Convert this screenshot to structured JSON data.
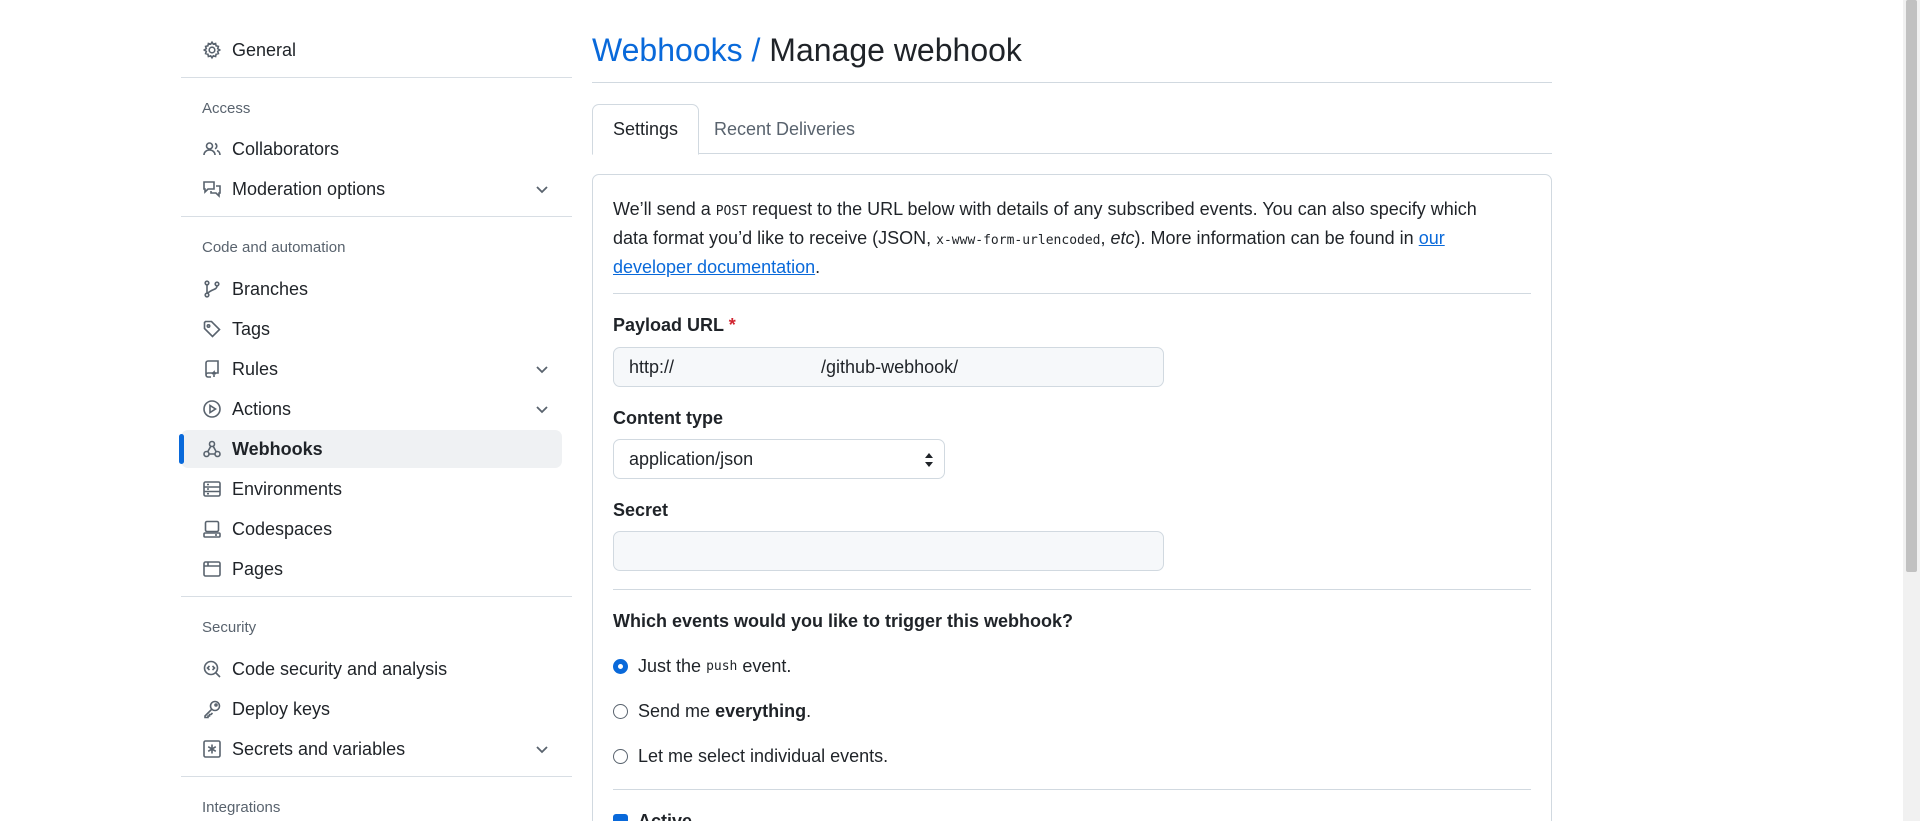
{
  "sidebar": {
    "top_item": {
      "label": "General",
      "icon": "gear-icon"
    },
    "groups": [
      {
        "heading": "Access",
        "items": [
          {
            "label": "Collaborators",
            "icon": "people-icon"
          },
          {
            "label": "Moderation options",
            "icon": "comment-discussion-icon",
            "expandable": true
          }
        ]
      },
      {
        "heading": "Code and automation",
        "items": [
          {
            "label": "Branches",
            "icon": "git-branch-icon"
          },
          {
            "label": "Tags",
            "icon": "tag-icon"
          },
          {
            "label": "Rules",
            "icon": "repo-push-icon",
            "expandable": true
          },
          {
            "label": "Actions",
            "icon": "play-icon",
            "expandable": true
          },
          {
            "label": "Webhooks",
            "icon": "webhook-icon",
            "active": true
          },
          {
            "label": "Environments",
            "icon": "server-icon"
          },
          {
            "label": "Codespaces",
            "icon": "codespaces-icon"
          },
          {
            "label": "Pages",
            "icon": "browser-icon"
          }
        ]
      },
      {
        "heading": "Security",
        "items": [
          {
            "label": "Code security and analysis",
            "icon": "codescan-icon"
          },
          {
            "label": "Deploy keys",
            "icon": "key-icon"
          },
          {
            "label": "Secrets and variables",
            "icon": "asterisk-icon",
            "expandable": true
          }
        ]
      },
      {
        "heading": "Integrations",
        "items": []
      }
    ]
  },
  "header": {
    "crumb": "Webhooks",
    "separator": "/",
    "title": "Manage webhook"
  },
  "tabs": [
    {
      "label": "Settings",
      "selected": true
    },
    {
      "label": "Recent Deliveries",
      "selected": false
    }
  ],
  "intro": {
    "p1": "We’ll send a ",
    "code1": "POST",
    "p2": " request to the URL below with details of any subscribed events. You can also specify which data format you’d like to receive (JSON, ",
    "code2": "x-www-form-urlencoded",
    "p3": ", ",
    "etc": "etc",
    "p4": "). More information can be found in ",
    "link": "our developer documentation",
    "p5": "."
  },
  "form": {
    "payload_label": "Payload URL",
    "required_mark": "*",
    "payload_prefix": "http://",
    "payload_suffix": "/github-webhook/",
    "content_type_label": "Content type",
    "content_type_value": "application/json",
    "secret_label": "Secret",
    "secret_value": ""
  },
  "events": {
    "question": "Which events would you like to trigger this webhook?",
    "opt1_pre": "Just the ",
    "opt1_code": "push",
    "opt1_post": " event.",
    "opt2_pre": "Send me ",
    "opt2_bold": "everything",
    "opt2_post": ".",
    "opt3": "Let me select individual events.",
    "selected": 1,
    "active_label": "Active",
    "active_checked": true
  },
  "colors": {
    "accent": "#0969da",
    "required": "#d1242f",
    "active_bg": "#eff1f3"
  }
}
